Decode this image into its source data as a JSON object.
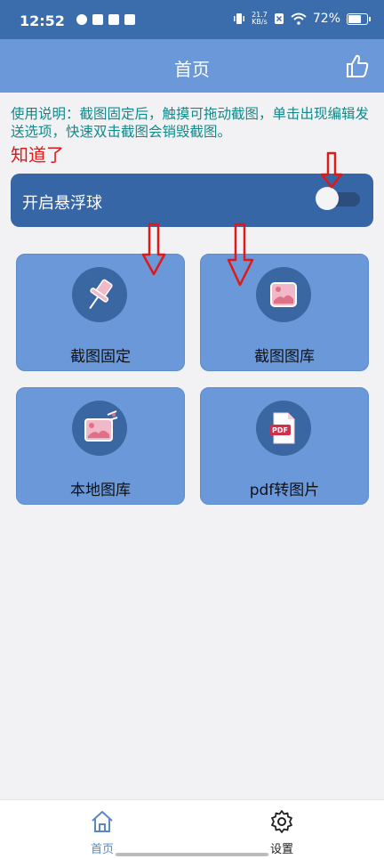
{
  "status_bar": {
    "time": "12:52",
    "speed_value": "21.7",
    "speed_unit": "KB/s",
    "battery": "72%"
  },
  "appbar": {
    "title": "首页",
    "like_icon": "thumbs-up-icon"
  },
  "instruction": {
    "text": "使用说明：截图固定后，触摸可拖动截图，单击出现编辑发送选项，快速双击截图会销毁截图。",
    "dismiss_label": "知道了"
  },
  "floating_ball": {
    "label": "开启悬浮球",
    "enabled": false
  },
  "cards": [
    {
      "label": "截图固定",
      "icon": "pushpin-icon"
    },
    {
      "label": "截图图库",
      "icon": "picture-icon"
    },
    {
      "label": "本地图库",
      "icon": "picture-edit-icon"
    },
    {
      "label": "pdf转图片",
      "icon": "pdf-file-icon"
    }
  ],
  "bottom_nav": [
    {
      "label": "首页",
      "icon": "home-icon",
      "active": true
    },
    {
      "label": "设置",
      "icon": "gear-icon",
      "active": false
    }
  ],
  "colors": {
    "status_bar": "#3b6cab",
    "app_bar": "#6a98d8",
    "instruction_text": "#0f8a8a",
    "dismiss_text": "#e01818",
    "float_row": "#3766a6",
    "card_bg": "#6a98d8",
    "icon_circle": "#3a66a2",
    "nav_active": "#5a88c7"
  }
}
